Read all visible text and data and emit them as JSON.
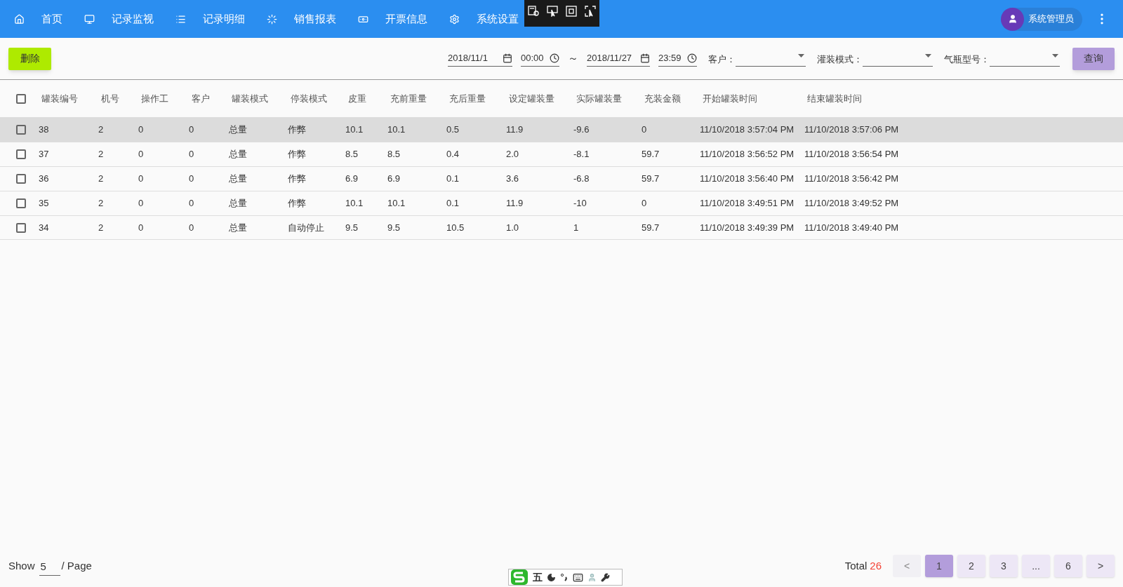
{
  "nav": [
    {
      "label": "首页"
    },
    {
      "label": "记录监视"
    },
    {
      "label": "记录明细"
    },
    {
      "label": "销售报表"
    },
    {
      "label": "开票信息"
    },
    {
      "label": "系统设置"
    }
  ],
  "user": {
    "name": "系统管理员"
  },
  "toolbar": {
    "delete_button": "删除",
    "start_date": "2018/11/1",
    "start_time": "00:00",
    "separator": "～",
    "end_date": "2018/11/27",
    "end_time": "23:59",
    "filters": [
      {
        "label": "客户："
      },
      {
        "label": "灌装模式："
      },
      {
        "label": "气瓶型号："
      }
    ],
    "query_button": "查询"
  },
  "table": {
    "columns": [
      "罐装编号",
      "机号",
      "操作工",
      "客户",
      "罐装模式",
      "停装模式",
      "皮重",
      "充前重量",
      "充后重量",
      "设定罐装量",
      "实际罐装量",
      "充装金额",
      "开始罐装时间",
      "结束罐装时间"
    ],
    "all_checked": false,
    "rows": [
      {
        "selected": true,
        "checked": false,
        "cells": [
          "38",
          "2",
          "0",
          "0",
          "总量",
          "作弊",
          "10.1",
          "10.1",
          "0.5",
          "11.9",
          "-9.6",
          "0",
          "11/10/2018 3:57:04 PM",
          "11/10/2018 3:57:06 PM"
        ]
      },
      {
        "selected": false,
        "checked": false,
        "cells": [
          "37",
          "2",
          "0",
          "0",
          "总量",
          "作弊",
          "8.5",
          "8.5",
          "0.4",
          "2.0",
          "-8.1",
          "59.7",
          "11/10/2018 3:56:52 PM",
          "11/10/2018 3:56:54 PM"
        ]
      },
      {
        "selected": false,
        "checked": false,
        "cells": [
          "36",
          "2",
          "0",
          "0",
          "总量",
          "作弊",
          "6.9",
          "6.9",
          "0.1",
          "3.6",
          "-6.8",
          "59.7",
          "11/10/2018 3:56:40 PM",
          "11/10/2018 3:56:42 PM"
        ]
      },
      {
        "selected": false,
        "checked": false,
        "cells": [
          "35",
          "2",
          "0",
          "0",
          "总量",
          "作弊",
          "10.1",
          "10.1",
          "0.1",
          "11.9",
          "-10",
          "0",
          "11/10/2018 3:49:51 PM",
          "11/10/2018 3:49:52 PM"
        ]
      },
      {
        "selected": false,
        "checked": false,
        "cells": [
          "34",
          "2",
          "0",
          "0",
          "总量",
          "自动停止",
          "9.5",
          "9.5",
          "10.5",
          "1.0",
          "1",
          "59.7",
          "11/10/2018 3:49:39 PM",
          "11/10/2018 3:49:40 PM"
        ]
      }
    ]
  },
  "footer": {
    "show_label": "Show",
    "page_size": "5",
    "page_label": "/ Page",
    "total_label": "Total",
    "total": "26",
    "pages": [
      {
        "label": "<",
        "selected": false,
        "disabled": true
      },
      {
        "label": "1",
        "selected": true,
        "disabled": false
      },
      {
        "label": "2",
        "selected": false,
        "disabled": false
      },
      {
        "label": "3",
        "selected": false,
        "disabled": false
      },
      {
        "label": "...",
        "selected": false,
        "disabled": false
      },
      {
        "label": "6",
        "selected": false,
        "disabled": false
      },
      {
        "label": ">",
        "selected": false,
        "disabled": false
      }
    ]
  },
  "ime_bar": {
    "mode": "五"
  }
}
